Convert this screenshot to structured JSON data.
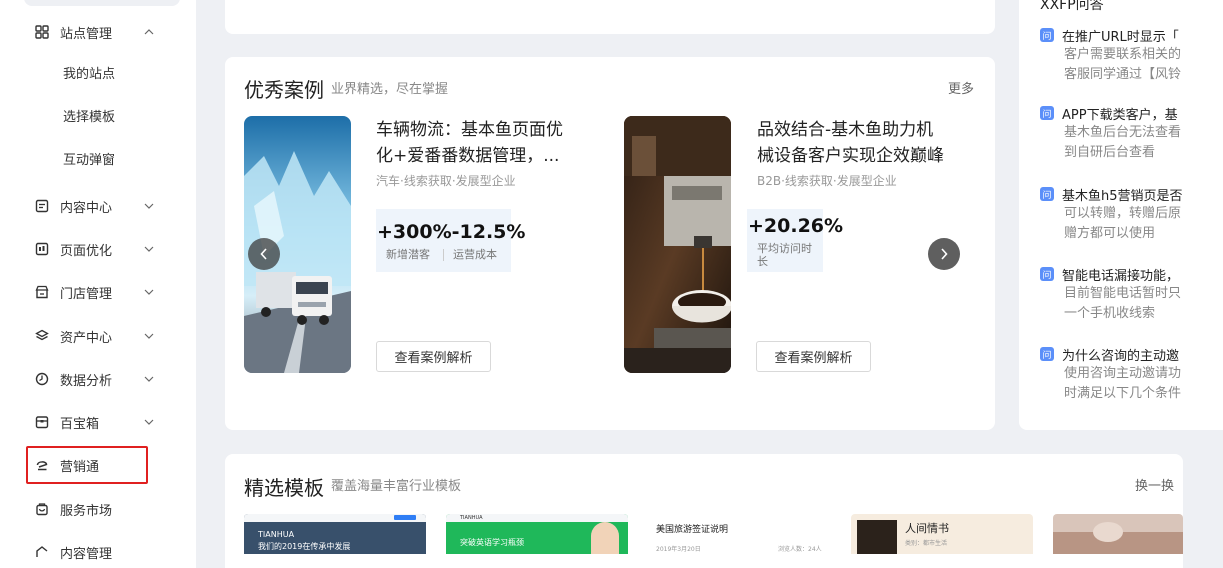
{
  "sidebar": {
    "items": [
      {
        "label": "站点管理",
        "icon": "grid-icon",
        "expanded": true
      },
      {
        "label": "内容中心",
        "icon": "content-icon"
      },
      {
        "label": "页面优化",
        "icon": "page-optimize-icon"
      },
      {
        "label": "门店管理",
        "icon": "store-icon"
      },
      {
        "label": "资产中心",
        "icon": "layers-icon"
      },
      {
        "label": "数据分析",
        "icon": "clock-chart-icon"
      },
      {
        "label": "百宝箱",
        "icon": "toolbox-icon"
      },
      {
        "label": "营销通",
        "icon": "marketing-icon"
      },
      {
        "label": "服务市场",
        "icon": "market-bag-icon"
      },
      {
        "label": "内容管理",
        "icon": "content-manage-icon"
      }
    ],
    "sub_items": [
      "我的站点",
      "选择模板",
      "互动弹窗"
    ],
    "highlight_color": "#e02020"
  },
  "cases": {
    "title": "优秀案例",
    "subtitle": "业界精选，尽在掌握",
    "more": "更多",
    "items": [
      {
        "title_line1": "车辆物流：基本鱼页面优",
        "title_line2": "化+爱番番数据管理，...",
        "tags": "汽车·线索获取·发展型企业",
        "stat_value": "+300%-12.5%",
        "stat_label1": "新增潜客",
        "stat_label2": "运营成本",
        "button": "查看案例解析"
      },
      {
        "title_line1": "品效结合-基木鱼助力机",
        "title_line2": "械设备客户实现企效巅峰",
        "tags": "B2B·线索获取·发展型企业",
        "stat_value": "+20.26%",
        "stat_label_line1": "平均访问时",
        "stat_label_line2": "长",
        "button": "查看案例解析"
      }
    ]
  },
  "faq": {
    "title": "XXFP问答",
    "items": [
      {
        "q": "在推广URL时显示「",
        "a1": "客户需要联系相关的",
        "a2": "客服同学通过【风铃"
      },
      {
        "q": "APP下载类客户，基",
        "a1": "基木鱼后台无法查看",
        "a2": "到自研后台查看"
      },
      {
        "q": "基木鱼h5营销页是否",
        "a1": "可以转赠，转赠后原",
        "a2": "赠方都可以使用"
      },
      {
        "q": "智能电话漏接功能，",
        "a1": "目前智能电话暂时只",
        "a2": "一个手机收线索"
      },
      {
        "q": "为什么咨询的主动邀",
        "a1": "使用咨询主动邀请功",
        "a2": "时满足以下几个条件"
      }
    ],
    "q_badge": "问"
  },
  "templates": {
    "title": "精选模板",
    "subtitle": "覆盖海量丰富行业模板",
    "refresh": "换一换",
    "thumbs": [
      {
        "brand": "TIANHUA",
        "line": "我们的2019在传承中发展"
      },
      {
        "brand": "TIANHUA",
        "line": "突破英语学习瓶颈"
      },
      {
        "heading": "美国旅游签证说明",
        "meta": "2019年3月20日",
        "meta2": "浏览人数：24人"
      },
      {
        "heading": "人间情书",
        "meta": "类别：都市生活"
      },
      {}
    ]
  }
}
